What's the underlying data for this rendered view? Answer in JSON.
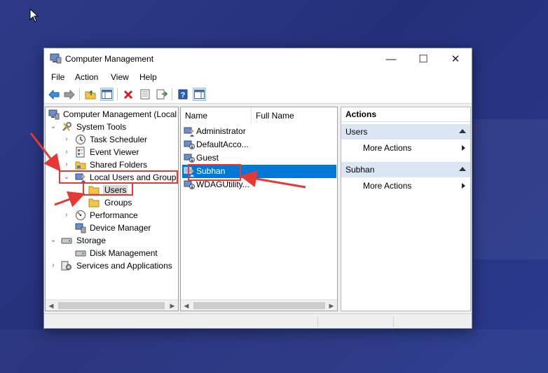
{
  "window": {
    "title": "Computer Management",
    "controls": {
      "minimize": "—",
      "maximize": "☐",
      "close": "✕"
    }
  },
  "menu": [
    "File",
    "Action",
    "View",
    "Help"
  ],
  "toolbar": [
    "back-arrow-icon",
    "forward-arrow-icon",
    "up-folder-icon",
    "show-hide-tree-icon",
    "delete-icon",
    "properties-icon",
    "export-list-icon",
    "help-icon",
    "show-action-pane-icon"
  ],
  "tree": {
    "root": "Computer Management (Local",
    "system_tools": "System Tools",
    "task_scheduler": "Task Scheduler",
    "event_viewer": "Event Viewer",
    "shared_folders": "Shared Folders",
    "local_users_groups": "Local Users and Groups",
    "users": "Users",
    "groups": "Groups",
    "performance": "Performance",
    "device_manager": "Device Manager",
    "storage": "Storage",
    "disk_management": "Disk Management",
    "services_apps": "Services and Applications"
  },
  "list": {
    "columns": [
      "Name",
      "Full Name"
    ],
    "rows": [
      "Administrator",
      "DefaultAcco...",
      "Guest",
      "Subhan",
      "WDAGUtility..."
    ],
    "selected": "Subhan"
  },
  "actions": {
    "title": "Actions",
    "sections": [
      {
        "header": "Users",
        "item": "More Actions"
      },
      {
        "header": "Subhan",
        "item": "More Actions"
      }
    ]
  },
  "colors": {
    "desktop": "#2a3584",
    "selection": "#0078d7",
    "action_section_bg": "#dbe6f4",
    "annotation": "#e53935"
  }
}
